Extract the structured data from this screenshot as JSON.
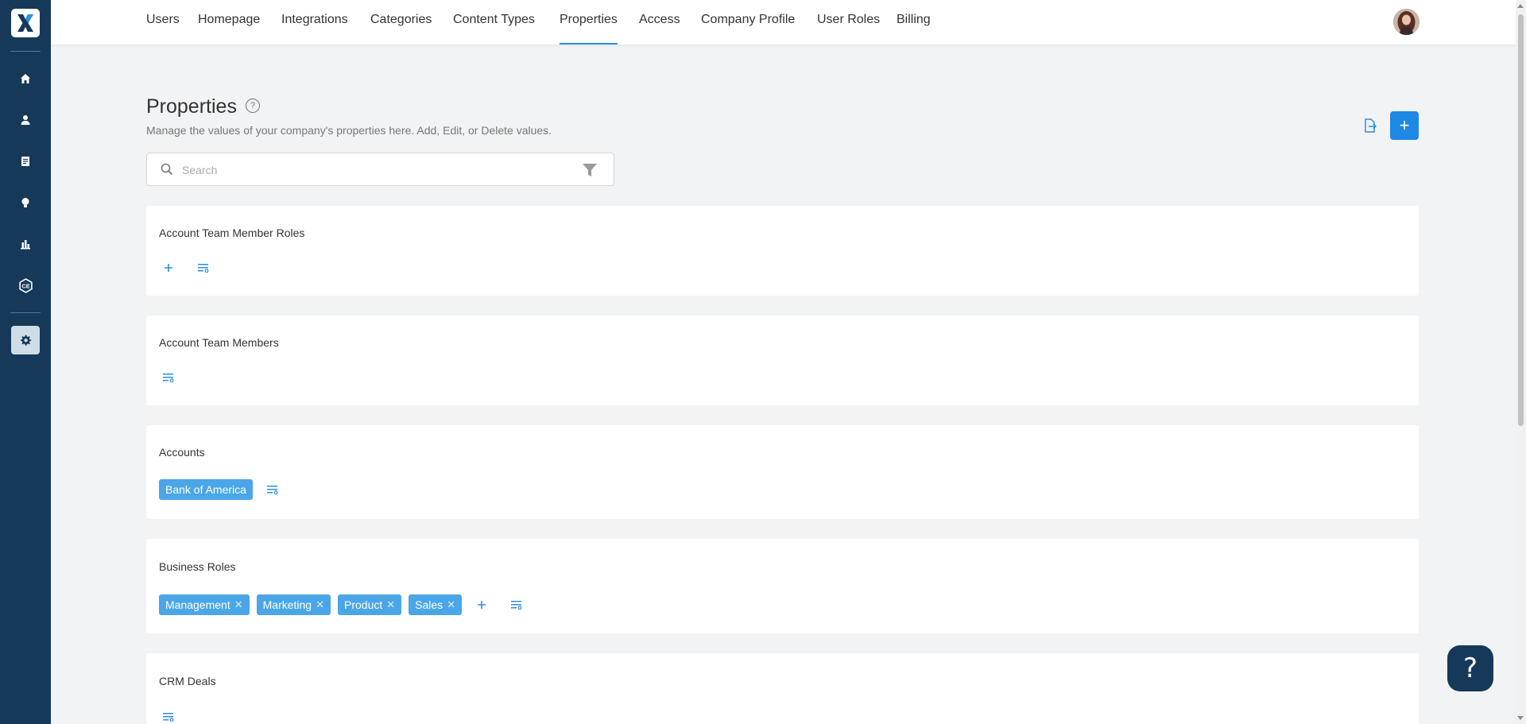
{
  "nav": {
    "tabs": [
      {
        "label": "Users"
      },
      {
        "label": "Homepage"
      },
      {
        "label": "Integrations"
      },
      {
        "label": "Categories"
      },
      {
        "label": "Content Types"
      },
      {
        "label": "Properties"
      },
      {
        "label": "Access"
      },
      {
        "label": "Company Profile"
      },
      {
        "label": "User Roles"
      },
      {
        "label": "Billing"
      }
    ],
    "active_tab": "Properties"
  },
  "sidebar": {
    "logo_letter": "X",
    "items": [
      "home-icon",
      "user-icon",
      "document-icon",
      "lightbulb-icon",
      "chart-icon",
      "ce-badge-icon",
      "gear-icon"
    ],
    "active_item": "gear-icon"
  },
  "page": {
    "title": "Properties",
    "help_symbol": "?",
    "subtitle": "Manage the values of your company's properties here. Add, Edit, or Delete values.",
    "add_symbol": "+"
  },
  "search": {
    "placeholder": "Search",
    "value": ""
  },
  "cards": [
    {
      "title": "Account Team Member Roles",
      "chips": [],
      "has_add": true
    },
    {
      "title": "Account Team Members",
      "chips": [],
      "has_add": false
    },
    {
      "title": "Accounts",
      "chips": [
        {
          "label": "Bank of America",
          "removable": false
        }
      ],
      "has_add": false
    },
    {
      "title": "Business Roles",
      "chips": [
        {
          "label": "Management",
          "removable": true
        },
        {
          "label": "Marketing",
          "removable": true
        },
        {
          "label": "Product",
          "removable": true
        },
        {
          "label": "Sales",
          "removable": true
        }
      ],
      "has_add": true
    },
    {
      "title": "CRM Deals",
      "chips": [],
      "has_add": false
    }
  ],
  "help_fab": "?",
  "colors": {
    "sidebar": "#16395a",
    "accent": "#1e88e5",
    "chip": "#4ba6e8",
    "background": "#f2f3f4"
  }
}
